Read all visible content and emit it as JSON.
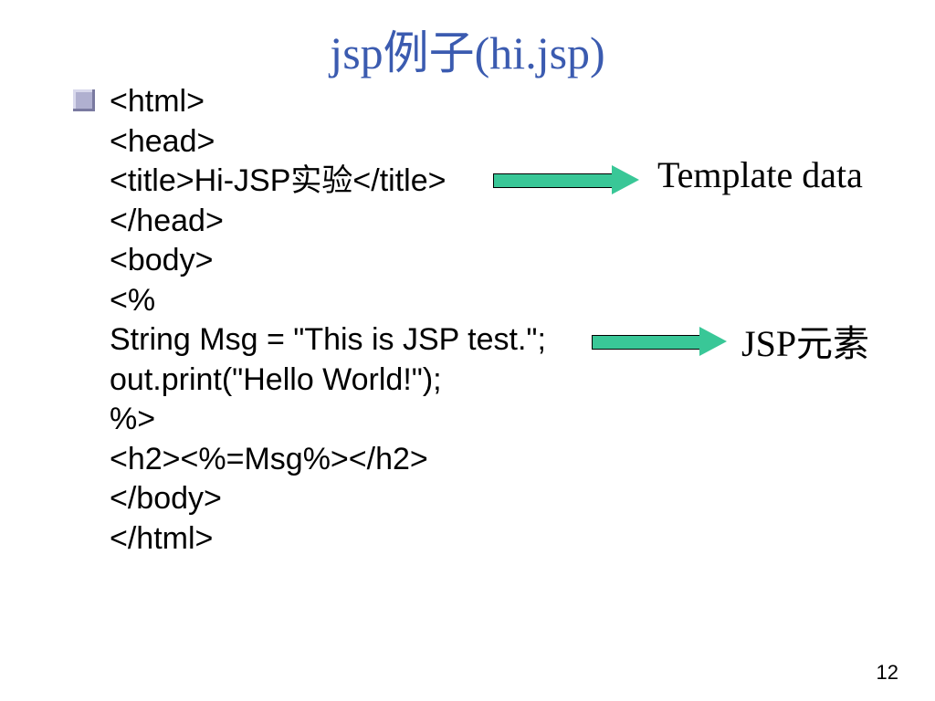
{
  "title": "jsp例子(hi.jsp)",
  "code": {
    "l1": "<html>",
    "l2": "<head>",
    "l3": "<title>Hi-JSP实验</title>",
    "l4": "</head>",
    "l5": "<body>",
    "l6": "<%",
    "l7": "String Msg = \"This is JSP test.\";",
    "l8": "out.print(\"Hello World!\");",
    "l9": "%>",
    "l10": "<h2><%=Msg%></h2>",
    "l11": "</body>",
    "l12": "</html>"
  },
  "labels": {
    "template_data": "Template data",
    "jsp_element": "JSP元素"
  },
  "page_number": "12"
}
